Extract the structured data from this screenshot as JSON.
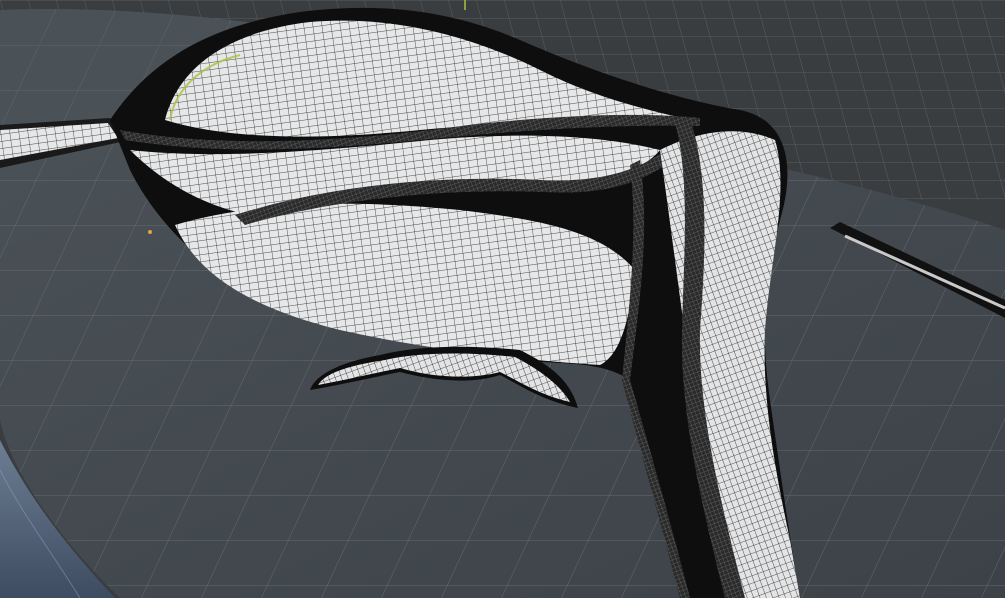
{
  "viewport": {
    "type": "3d-viewport",
    "view": "perspective",
    "shading": "wireframe",
    "background": "#3a3d40",
    "ground_color": "#4a5056",
    "surface_color": "#d9dadb",
    "wire_color": "#111111",
    "sky_color": "#5e6f86",
    "axis_color": "#a8c23a",
    "origin_color": "#e8a23a"
  }
}
